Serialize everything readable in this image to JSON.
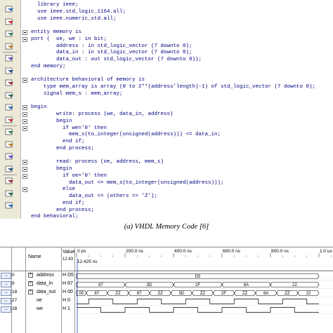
{
  "editor": {
    "lines": [
      {
        "indent": 2,
        "text": "library ieee;",
        "marker": "none"
      },
      {
        "indent": 2,
        "text": "use ieee.std_logic_1164.all;",
        "marker": "none"
      },
      {
        "indent": 2,
        "text": "use ieee.numeric_std.all;",
        "marker": "none"
      },
      {
        "indent": 0,
        "text": "",
        "marker": "none"
      },
      {
        "indent": 0,
        "text": "entity memory is",
        "marker": "fold"
      },
      {
        "indent": 0,
        "text": "port (  oe, we : in bit;",
        "marker": "fold"
      },
      {
        "indent": 8,
        "text": "address : in std_logic_vector (7 downto 0);",
        "marker": "none"
      },
      {
        "indent": 8,
        "text": "data_in : in std_logic_vector (7 downto 0);",
        "marker": "none"
      },
      {
        "indent": 8,
        "text": "data_out : out std_logic_vector (7 downto 0));",
        "marker": "none"
      },
      {
        "indent": 0,
        "text": "end memory;",
        "marker": "none"
      },
      {
        "indent": 0,
        "text": "",
        "marker": "none"
      },
      {
        "indent": 0,
        "text": "architecture behavioral of memory is",
        "marker": "fold"
      },
      {
        "indent": 4,
        "text": "type mem_array is array (0 to 2**(address'length)-1) of std_logic_vector (7 downto 0);",
        "marker": "none"
      },
      {
        "indent": 4,
        "text": "signal mem_s : mem_array;",
        "marker": "none"
      },
      {
        "indent": 0,
        "text": "",
        "marker": "none"
      },
      {
        "indent": 0,
        "text": "begin",
        "marker": "fold"
      },
      {
        "indent": 8,
        "text": "write: process (we, data_in, address)",
        "marker": "fold"
      },
      {
        "indent": 8,
        "text": "begin",
        "marker": "fold"
      },
      {
        "indent": 10,
        "text": "if we='0' then",
        "marker": "fold"
      },
      {
        "indent": 12,
        "text": "mem_s(to_integer(unsigned(address))) <= data_in;",
        "marker": "none"
      },
      {
        "indent": 10,
        "text": "end if;",
        "marker": "none"
      },
      {
        "indent": 8,
        "text": "end process;",
        "marker": "none"
      },
      {
        "indent": 0,
        "text": "",
        "marker": "none"
      },
      {
        "indent": 8,
        "text": "read: process (oe, address, mem_s)",
        "marker": "fold"
      },
      {
        "indent": 8,
        "text": "begin",
        "marker": "fold"
      },
      {
        "indent": 10,
        "text": "if oe='0' then",
        "marker": "fold"
      },
      {
        "indent": 12,
        "text": "data_out <= mem_s(to_integer(unsigned(address)));",
        "marker": "none"
      },
      {
        "indent": 10,
        "text": "else",
        "marker": "fold"
      },
      {
        "indent": 12,
        "text": "data_out <= (others => 'Z');",
        "marker": "none"
      },
      {
        "indent": 10,
        "text": "end if;",
        "marker": "none"
      },
      {
        "indent": 8,
        "text": "end process;",
        "marker": "none"
      },
      {
        "indent": 0,
        "text": "end behavioral;",
        "marker": "none"
      }
    ],
    "toolbar_icons": [
      "open-file-icon",
      "save-icon",
      "undo-icon",
      "redo-icon",
      "indent-icon",
      "outdent-icon",
      "comment-icon",
      "uncomment-icon",
      "bookmark-icon",
      "find-icon",
      "replace-icon",
      "goto-line-icon",
      "wrap-icon",
      "compile-icon",
      "list-icon",
      "settings-icon",
      "align-icon"
    ]
  },
  "caption_a": "(a) VHDL Memory Code [6]",
  "waveform": {
    "header": {
      "name_col": "Name",
      "value_col": "Value",
      "value_sub": "12.43",
      "time_zero": "0 ps",
      "cursor_time": "12.425 ns",
      "ticks": [
        "0 ps",
        "200.0 ns",
        "400.0 ns",
        "600.0 ns",
        "800.0 ns",
        "1.0 us"
      ]
    },
    "signals": [
      {
        "num": "0",
        "name": "address",
        "value": "H D5",
        "expandable": true
      },
      {
        "num": "9",
        "name": "data_in",
        "value": "H 87",
        "expandable": true
      },
      {
        "num": "18",
        "name": "data_out",
        "value": "H 00",
        "expandable": true
      },
      {
        "num": "27",
        "name": "oe",
        "value": "H 0",
        "expandable": false
      },
      {
        "num": "28",
        "name": "we",
        "value": "H 1",
        "expandable": false
      }
    ],
    "address_bus": [
      "D5"
    ],
    "data_in_bus": [
      "87",
      "3D",
      "2F",
      "8A",
      "22"
    ],
    "data_out_bus": [
      "00",
      "87",
      "ZZ",
      "87",
      "ZZ",
      "3D",
      "ZZ",
      "2F",
      "ZZ",
      "8A",
      "ZZ",
      "22"
    ],
    "oe_levels": [
      0,
      1,
      1,
      0,
      0,
      1,
      1,
      0,
      0,
      1,
      1,
      0,
      0,
      1,
      1,
      0,
      0,
      1,
      1,
      0
    ],
    "we_levels": [
      1,
      1,
      0,
      0,
      1,
      1,
      0,
      0,
      1,
      1,
      0,
      0,
      1,
      1,
      0,
      0,
      1,
      1,
      0,
      0
    ]
  }
}
